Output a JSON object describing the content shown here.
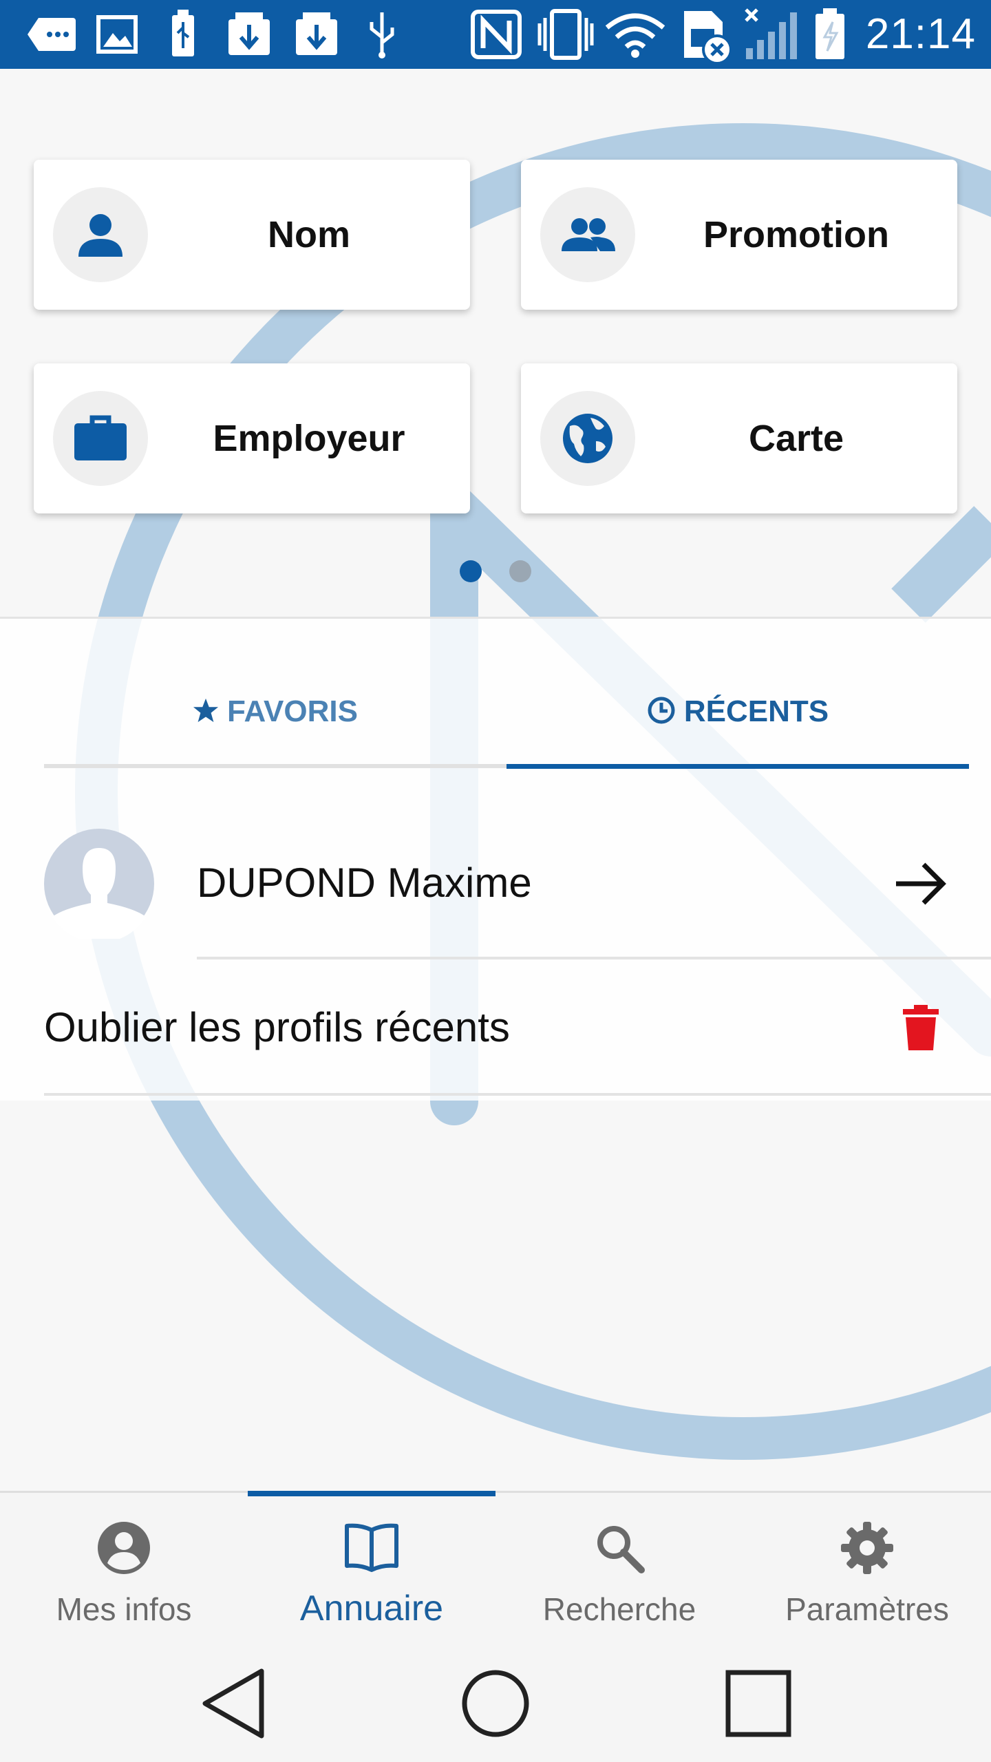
{
  "status_bar": {
    "time": "21:14",
    "icons": [
      "message-icon",
      "image-icon",
      "usb-icon",
      "download-icon",
      "download-icon",
      "usb-icon",
      "nfc-icon",
      "vibrate-icon",
      "wifi-icon",
      "sim-no-service-icon",
      "signal-icon",
      "battery-charging-icon"
    ]
  },
  "shortcuts": [
    {
      "label": "Nom",
      "icon": "person-icon"
    },
    {
      "label": "Promotion",
      "icon": "group-icon"
    },
    {
      "label": "Employeur",
      "icon": "briefcase-icon"
    },
    {
      "label": "Carte",
      "icon": "globe-icon"
    }
  ],
  "pager": {
    "pages": 2,
    "current": 1
  },
  "tabs": {
    "favorites": "FAVORIS",
    "recents": "RÉCENTS",
    "active": "recents"
  },
  "recents": {
    "items": [
      {
        "name": "DUPOND Maxime"
      }
    ],
    "clear_label": "Oublier les profils récents"
  },
  "bottom_nav": [
    {
      "label": "Mes infos",
      "icon": "account-circle-icon"
    },
    {
      "label": "Annuaire",
      "icon": "book-icon",
      "active": true
    },
    {
      "label": "Recherche",
      "icon": "search-icon"
    },
    {
      "label": "Paramètres",
      "icon": "gear-icon"
    }
  ],
  "colors": {
    "primary": "#0d5ca5",
    "tab_text": "#1b5f9d",
    "delete": "#e3151f",
    "background_deco": "#b2cde3"
  }
}
